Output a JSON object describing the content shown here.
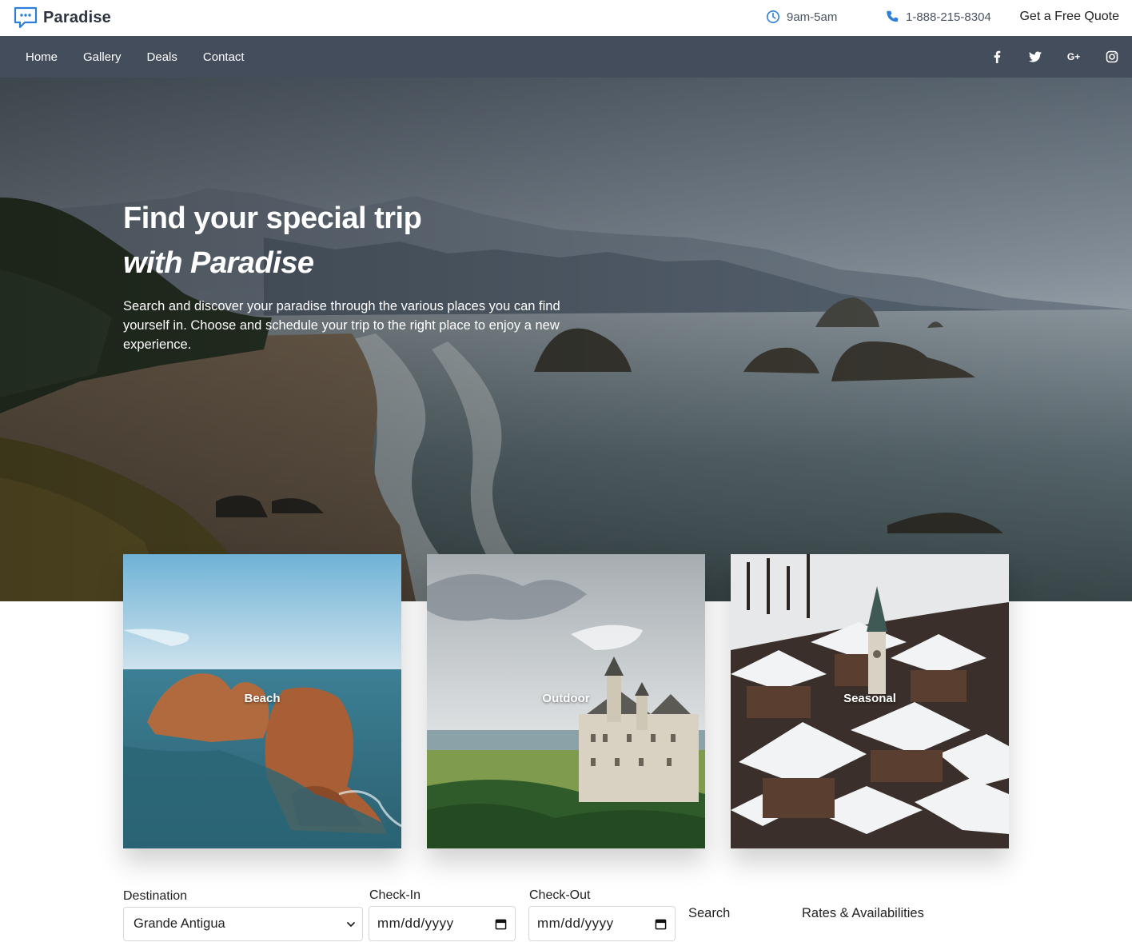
{
  "brand": {
    "name": "Paradise"
  },
  "topbar": {
    "hours": "9am-5am",
    "phone": "1-888-215-8304",
    "quote": "Get a Free Quote"
  },
  "nav": {
    "items": [
      {
        "label": "Home"
      },
      {
        "label": "Gallery"
      },
      {
        "label": "Deals"
      },
      {
        "label": "Contact"
      }
    ],
    "socials": [
      "facebook-icon",
      "twitter-icon",
      "google-plus-icon",
      "instagram-icon"
    ],
    "google_plus_text": "G+"
  },
  "hero": {
    "title": "Find your special trip",
    "subtitle": "with Paradise",
    "description": "Search and discover your paradise through the various places you can find yourself in. Choose and schedule your trip to the right place to enjoy a new experience."
  },
  "cards": [
    {
      "label": "Beach"
    },
    {
      "label": "Outdoor"
    },
    {
      "label": "Seasonal"
    }
  ],
  "search": {
    "destination_label": "Destination",
    "destination_value": "Grande Antigua",
    "checkin_label": "Check-In",
    "checkin_placeholder": "mm/dd/yyyy",
    "checkout_label": "Check-Out",
    "checkout_placeholder": "mm/dd/yyyy",
    "search_label": "Search",
    "rates_label": "Rates & Availabilities"
  },
  "colors": {
    "navbar": "#444d5c",
    "brand_accent": "#2e7fd6",
    "text": "#222222"
  }
}
